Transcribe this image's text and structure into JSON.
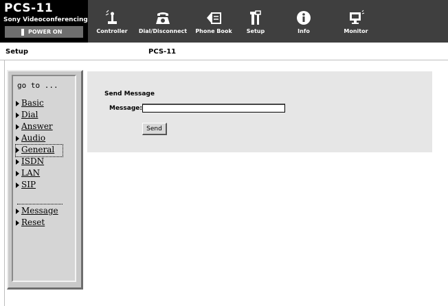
{
  "brand": {
    "name": "PCS-11",
    "subtitle": "Sony Videoconferencing",
    "power_status": "POWER ON"
  },
  "nav": [
    {
      "label": "Controller",
      "icon": "controller-icon"
    },
    {
      "label": "Dial/Disconnect",
      "icon": "dial-disconnect-icon"
    },
    {
      "label": "Phone Book",
      "icon": "phone-book-icon"
    },
    {
      "label": "Setup",
      "icon": "setup-tools-icon"
    },
    {
      "label": "Info",
      "icon": "info-icon"
    },
    {
      "label": "Monitor",
      "icon": "monitor-icon"
    }
  ],
  "header": {
    "section": "Setup",
    "device": "PCS-11"
  },
  "goto": {
    "title": "go to ...",
    "items": [
      {
        "label": "Basic"
      },
      {
        "label": "Dial"
      },
      {
        "label": "Answer"
      },
      {
        "label": "Audio"
      },
      {
        "label": "General",
        "selected": true
      },
      {
        "label": "ISDN"
      },
      {
        "label": "LAN"
      },
      {
        "label": "SIP"
      }
    ],
    "extra_items": [
      {
        "label": "Message"
      },
      {
        "label": "Reset"
      }
    ]
  },
  "form": {
    "heading": "Send Message",
    "message_label": "Message:",
    "message_value": "",
    "send_label": "Send"
  },
  "colors": {
    "banner": "#3f3f3f",
    "brand_bg": "#000000",
    "panel": "#e6e6e6",
    "sidebar": "#c9c9c9"
  }
}
